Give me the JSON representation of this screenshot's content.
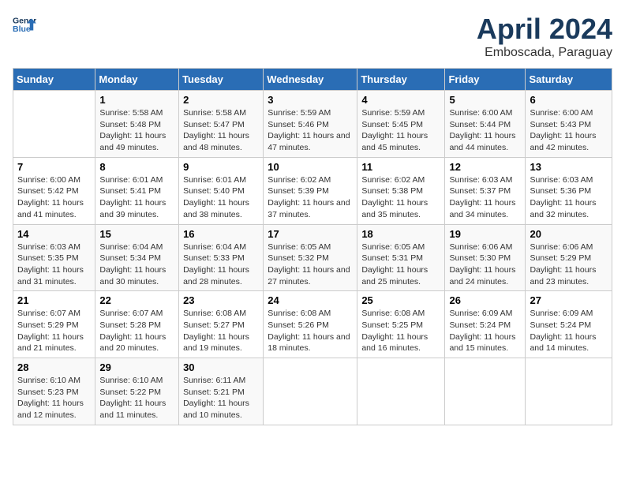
{
  "header": {
    "logo_line1": "General",
    "logo_line2": "Blue",
    "month_title": "April 2024",
    "subtitle": "Emboscada, Paraguay"
  },
  "weekdays": [
    "Sunday",
    "Monday",
    "Tuesday",
    "Wednesday",
    "Thursday",
    "Friday",
    "Saturday"
  ],
  "weeks": [
    [
      {
        "day": "",
        "sunrise": "",
        "sunset": "",
        "daylight": ""
      },
      {
        "day": "1",
        "sunrise": "Sunrise: 5:58 AM",
        "sunset": "Sunset: 5:48 PM",
        "daylight": "Daylight: 11 hours and 49 minutes."
      },
      {
        "day": "2",
        "sunrise": "Sunrise: 5:58 AM",
        "sunset": "Sunset: 5:47 PM",
        "daylight": "Daylight: 11 hours and 48 minutes."
      },
      {
        "day": "3",
        "sunrise": "Sunrise: 5:59 AM",
        "sunset": "Sunset: 5:46 PM",
        "daylight": "Daylight: 11 hours and 47 minutes."
      },
      {
        "day": "4",
        "sunrise": "Sunrise: 5:59 AM",
        "sunset": "Sunset: 5:45 PM",
        "daylight": "Daylight: 11 hours and 45 minutes."
      },
      {
        "day": "5",
        "sunrise": "Sunrise: 6:00 AM",
        "sunset": "Sunset: 5:44 PM",
        "daylight": "Daylight: 11 hours and 44 minutes."
      },
      {
        "day": "6",
        "sunrise": "Sunrise: 6:00 AM",
        "sunset": "Sunset: 5:43 PM",
        "daylight": "Daylight: 11 hours and 42 minutes."
      }
    ],
    [
      {
        "day": "7",
        "sunrise": "Sunrise: 6:00 AM",
        "sunset": "Sunset: 5:42 PM",
        "daylight": "Daylight: 11 hours and 41 minutes."
      },
      {
        "day": "8",
        "sunrise": "Sunrise: 6:01 AM",
        "sunset": "Sunset: 5:41 PM",
        "daylight": "Daylight: 11 hours and 39 minutes."
      },
      {
        "day": "9",
        "sunrise": "Sunrise: 6:01 AM",
        "sunset": "Sunset: 5:40 PM",
        "daylight": "Daylight: 11 hours and 38 minutes."
      },
      {
        "day": "10",
        "sunrise": "Sunrise: 6:02 AM",
        "sunset": "Sunset: 5:39 PM",
        "daylight": "Daylight: 11 hours and 37 minutes."
      },
      {
        "day": "11",
        "sunrise": "Sunrise: 6:02 AM",
        "sunset": "Sunset: 5:38 PM",
        "daylight": "Daylight: 11 hours and 35 minutes."
      },
      {
        "day": "12",
        "sunrise": "Sunrise: 6:03 AM",
        "sunset": "Sunset: 5:37 PM",
        "daylight": "Daylight: 11 hours and 34 minutes."
      },
      {
        "day": "13",
        "sunrise": "Sunrise: 6:03 AM",
        "sunset": "Sunset: 5:36 PM",
        "daylight": "Daylight: 11 hours and 32 minutes."
      }
    ],
    [
      {
        "day": "14",
        "sunrise": "Sunrise: 6:03 AM",
        "sunset": "Sunset: 5:35 PM",
        "daylight": "Daylight: 11 hours and 31 minutes."
      },
      {
        "day": "15",
        "sunrise": "Sunrise: 6:04 AM",
        "sunset": "Sunset: 5:34 PM",
        "daylight": "Daylight: 11 hours and 30 minutes."
      },
      {
        "day": "16",
        "sunrise": "Sunrise: 6:04 AM",
        "sunset": "Sunset: 5:33 PM",
        "daylight": "Daylight: 11 hours and 28 minutes."
      },
      {
        "day": "17",
        "sunrise": "Sunrise: 6:05 AM",
        "sunset": "Sunset: 5:32 PM",
        "daylight": "Daylight: 11 hours and 27 minutes."
      },
      {
        "day": "18",
        "sunrise": "Sunrise: 6:05 AM",
        "sunset": "Sunset: 5:31 PM",
        "daylight": "Daylight: 11 hours and 25 minutes."
      },
      {
        "day": "19",
        "sunrise": "Sunrise: 6:06 AM",
        "sunset": "Sunset: 5:30 PM",
        "daylight": "Daylight: 11 hours and 24 minutes."
      },
      {
        "day": "20",
        "sunrise": "Sunrise: 6:06 AM",
        "sunset": "Sunset: 5:29 PM",
        "daylight": "Daylight: 11 hours and 23 minutes."
      }
    ],
    [
      {
        "day": "21",
        "sunrise": "Sunrise: 6:07 AM",
        "sunset": "Sunset: 5:29 PM",
        "daylight": "Daylight: 11 hours and 21 minutes."
      },
      {
        "day": "22",
        "sunrise": "Sunrise: 6:07 AM",
        "sunset": "Sunset: 5:28 PM",
        "daylight": "Daylight: 11 hours and 20 minutes."
      },
      {
        "day": "23",
        "sunrise": "Sunrise: 6:08 AM",
        "sunset": "Sunset: 5:27 PM",
        "daylight": "Daylight: 11 hours and 19 minutes."
      },
      {
        "day": "24",
        "sunrise": "Sunrise: 6:08 AM",
        "sunset": "Sunset: 5:26 PM",
        "daylight": "Daylight: 11 hours and 18 minutes."
      },
      {
        "day": "25",
        "sunrise": "Sunrise: 6:08 AM",
        "sunset": "Sunset: 5:25 PM",
        "daylight": "Daylight: 11 hours and 16 minutes."
      },
      {
        "day": "26",
        "sunrise": "Sunrise: 6:09 AM",
        "sunset": "Sunset: 5:24 PM",
        "daylight": "Daylight: 11 hours and 15 minutes."
      },
      {
        "day": "27",
        "sunrise": "Sunrise: 6:09 AM",
        "sunset": "Sunset: 5:24 PM",
        "daylight": "Daylight: 11 hours and 14 minutes."
      }
    ],
    [
      {
        "day": "28",
        "sunrise": "Sunrise: 6:10 AM",
        "sunset": "Sunset: 5:23 PM",
        "daylight": "Daylight: 11 hours and 12 minutes."
      },
      {
        "day": "29",
        "sunrise": "Sunrise: 6:10 AM",
        "sunset": "Sunset: 5:22 PM",
        "daylight": "Daylight: 11 hours and 11 minutes."
      },
      {
        "day": "30",
        "sunrise": "Sunrise: 6:11 AM",
        "sunset": "Sunset: 5:21 PM",
        "daylight": "Daylight: 11 hours and 10 minutes."
      },
      {
        "day": "",
        "sunrise": "",
        "sunset": "",
        "daylight": ""
      },
      {
        "day": "",
        "sunrise": "",
        "sunset": "",
        "daylight": ""
      },
      {
        "day": "",
        "sunrise": "",
        "sunset": "",
        "daylight": ""
      },
      {
        "day": "",
        "sunrise": "",
        "sunset": "",
        "daylight": ""
      }
    ]
  ]
}
